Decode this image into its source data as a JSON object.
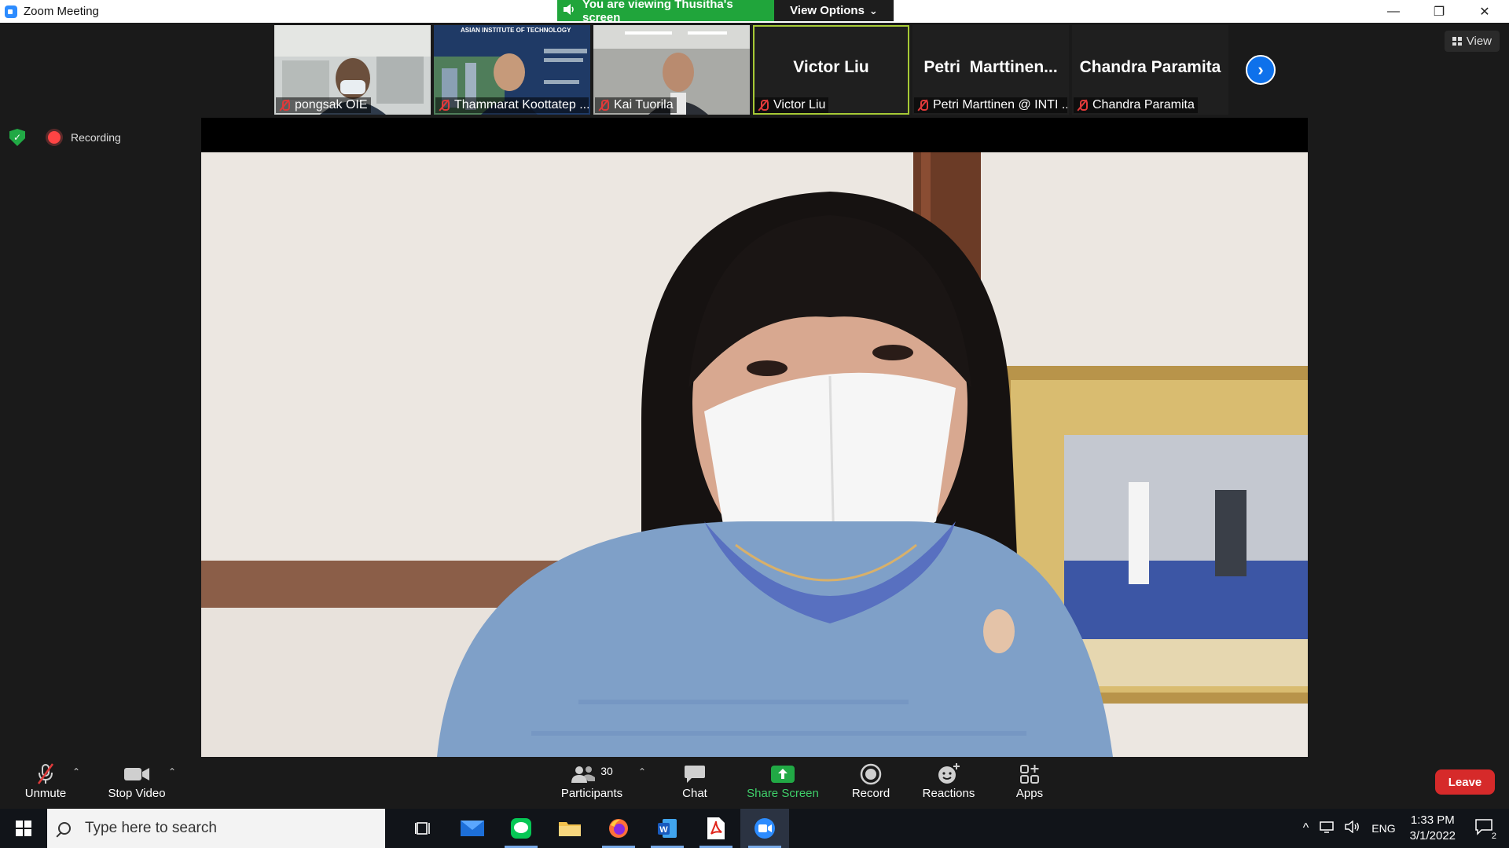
{
  "window": {
    "title": "Zoom Meeting",
    "controls": {
      "minimize": "—",
      "restore": "❐",
      "close": "✕"
    }
  },
  "banner": {
    "viewing_text": "You are viewing Thusitha's screen",
    "view_options_label": "View Options",
    "view_options_caret": "⌄"
  },
  "thumbnails": [
    {
      "label": "pongsak OIE",
      "type": "video"
    },
    {
      "label": "Thammarat Koottatep ...",
      "type": "video",
      "slide_title": "ASIAN INSTITUTE OF TECHNOLOGY"
    },
    {
      "label": "Kai Tuorila",
      "type": "video"
    },
    {
      "label": "Victor Liu",
      "big_name": "Victor Liu",
      "type": "name"
    },
    {
      "label": "Petri Marttinen @ INTI ...",
      "big_name": "Petri  Marttinen...",
      "type": "name"
    },
    {
      "label": "Chandra Paramita",
      "big_name": "Chandra Paramita",
      "type": "name"
    }
  ],
  "strip_next": "›",
  "view_button": {
    "label": "View"
  },
  "recording": {
    "label": "Recording",
    "shield_check": "✓"
  },
  "toolbar": {
    "unmute": "Unmute",
    "stop_video": "Stop Video",
    "participants": "Participants",
    "participants_count": "30",
    "chat": "Chat",
    "share_screen": "Share Screen",
    "record": "Record",
    "reactions": "Reactions",
    "apps": "Apps",
    "leave": "Leave",
    "caret": "⌃"
  },
  "taskbar": {
    "search_placeholder": "Type here to search",
    "apps": [
      "task-view",
      "mail",
      "line",
      "file-explorer",
      "firefox",
      "word",
      "acrobat",
      "zoom"
    ],
    "tray": {
      "language": "ENG",
      "time": "1:33 PM",
      "date": "3/1/2022",
      "notification_count": "2",
      "chevron": "^"
    }
  },
  "colors": {
    "banner_green": "#20a53b",
    "active_border": "#a6c935",
    "leave_red": "#d62a2a",
    "share_green": "#21a945",
    "accent_blue": "#0e71eb"
  }
}
